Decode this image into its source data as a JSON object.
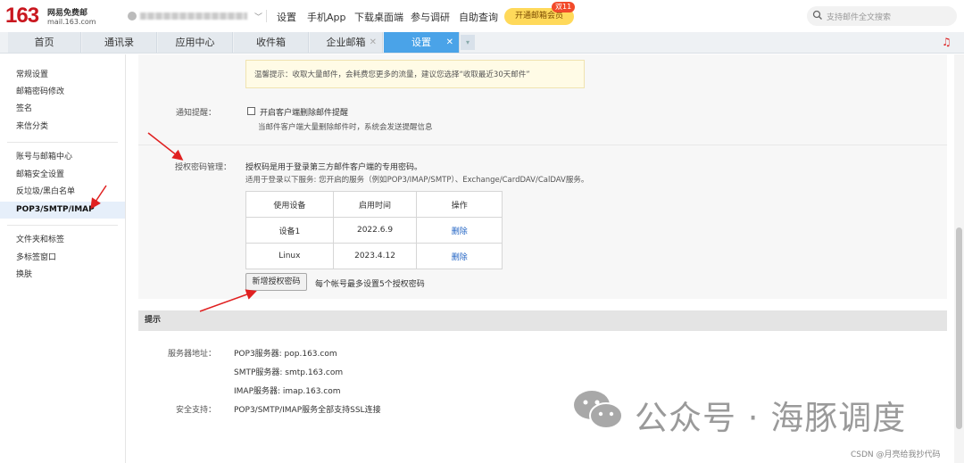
{
  "header": {
    "logo_number": "163",
    "logo_title": "网易免费邮",
    "logo_domain": "mail.163.com",
    "nav": [
      "设置",
      "手机App",
      "下载桌面端",
      "参与调研",
      "自助查询"
    ],
    "vip_button": "开通邮箱会员",
    "vip_badge": "双11",
    "search_placeholder": "支持邮件全文搜索"
  },
  "tabs": [
    "首页",
    "通讯录",
    "应用中心",
    "收件箱",
    "企业邮箱",
    "设置"
  ],
  "sidebar": {
    "group1": [
      "常规设置",
      "邮箱密码修改",
      "签名",
      "来信分类"
    ],
    "group2": [
      "账号与邮箱中心",
      "邮箱安全设置",
      "反垃圾/黑白名单",
      "POP3/SMTP/IMAP"
    ],
    "group3": [
      "文件夹和标签",
      "多标签窗口",
      "换肤"
    ]
  },
  "settings": {
    "notice": "温馨提示：收取大量邮件，会耗费您更多的流量，建议您选择“收取最近30天邮件”",
    "notify_label": "通知提醒：",
    "notify_checkbox": "开启客户端删除邮件提醒",
    "notify_desc": "当邮件客户端大量删除邮件时，系统会发送提醒信息",
    "auth_label": "授权密码管理：",
    "auth_desc1": "授权码是用于登录第三方邮件客户端的专用密码。",
    "auth_desc2": "适用于登录以下服务: 您开启的服务（例如POP3/IMAP/SMTP）、Exchange/CardDAV/CalDAV服务。",
    "table_headers": [
      "使用设备",
      "启用时间",
      "操作"
    ],
    "table_rows": [
      {
        "device": "设备1",
        "time": "2022.6.9",
        "action": "删除"
      },
      {
        "device": "Linux",
        "time": "2023.4.12",
        "action": "删除"
      }
    ],
    "add_button": "新增授权密码",
    "add_hint": "每个帐号最多设置5个授权密码"
  },
  "tips": {
    "title": "提示",
    "server_label": "服务器地址：",
    "pop3": "POP3服务器: pop.163.com",
    "smtp": "SMTP服务器: smtp.163.com",
    "imap": "IMAP服务器: imap.163.com",
    "security_label": "安全支持：",
    "security": "POP3/SMTP/IMAP服务全部支持SSL连接"
  },
  "watermark": {
    "text": "公众号 · 海豚调度",
    "credit": "CSDN @月亮给我抄代码"
  },
  "colors": {
    "brand_red": "#c9171f",
    "active_tab": "#4aa3e8",
    "link_blue": "#2264c4",
    "annotation_red": "#e02020"
  }
}
